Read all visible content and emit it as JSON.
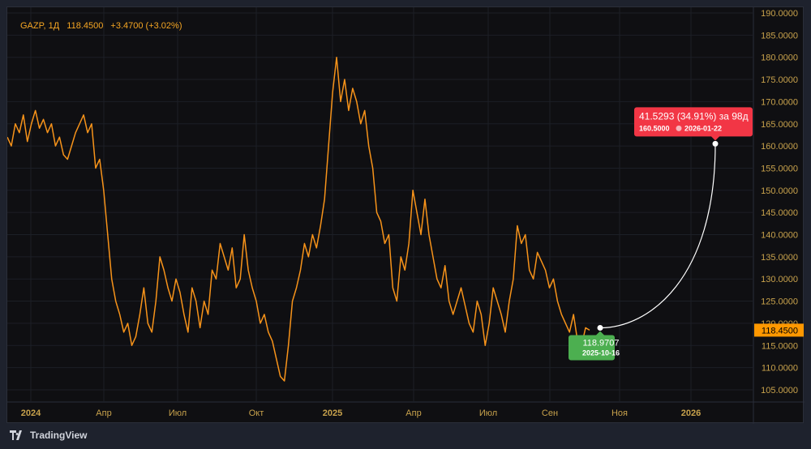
{
  "header": {
    "symbol": "GAZP, 1Д",
    "price": "118.4500",
    "change": "+3.4700 (+3.02%)"
  },
  "footer": {
    "brand": "TradingView"
  },
  "colors": {
    "line": "#f7931a",
    "accent": "#ff9800",
    "up_label": "#4caf50",
    "target_label": "#f23645",
    "axis_text": "#c8a24c"
  },
  "chart_data": {
    "type": "line",
    "title": "GAZP, 1Д",
    "xlabel": "",
    "ylabel": "",
    "ylim": [
      103,
      191
    ],
    "y_ticks": [
      "190.0000",
      "185.0000",
      "180.0000",
      "175.0000",
      "170.0000",
      "165.0000",
      "160.0000",
      "155.0000",
      "150.0000",
      "145.0000",
      "140.0000",
      "135.0000",
      "130.0000",
      "125.0000",
      "120.0000",
      "115.0000",
      "110.0000",
      "105.0000"
    ],
    "x_ticks": [
      "2024",
      "Апр",
      "Июл",
      "Окт",
      "2025",
      "Апр",
      "Июл",
      "Сен",
      "Ноя",
      "2026"
    ],
    "grid": true,
    "series": [
      {
        "name": "GAZP",
        "start_date": "2023-12",
        "end_date": "2025-10-16",
        "values": [
          162,
          160,
          165,
          163,
          167,
          161,
          165,
          168,
          164,
          166,
          163,
          165,
          160,
          162,
          158,
          157,
          160,
          163,
          165,
          167,
          163,
          165,
          155,
          157,
          150,
          140,
          130,
          125,
          122,
          118,
          120,
          115,
          117,
          122,
          128,
          120,
          118,
          125,
          135,
          132,
          128,
          125,
          130,
          127,
          122,
          118,
          128,
          125,
          119,
          125,
          122,
          132,
          130,
          138,
          135,
          132,
          137,
          128,
          130,
          140,
          132,
          128,
          125,
          120,
          122,
          118,
          116,
          112,
          108,
          107,
          115,
          125,
          128,
          132,
          138,
          135,
          140,
          137,
          142,
          148,
          160,
          172,
          180,
          170,
          175,
          168,
          173,
          170,
          165,
          168,
          160,
          155,
          145,
          143,
          138,
          140,
          128,
          125,
          135,
          132,
          138,
          150,
          145,
          140,
          148,
          140,
          135,
          130,
          128,
          133,
          125,
          122,
          125,
          128,
          124,
          120,
          118,
          125,
          122,
          115,
          120,
          128,
          125,
          122,
          118,
          125,
          130,
          142,
          138,
          140,
          132,
          130,
          136,
          134,
          132,
          128,
          130,
          125,
          122,
          120,
          118,
          122,
          116,
          115,
          119,
          118.45
        ]
      }
    ],
    "last_price_label": "118.4500",
    "projection": {
      "start_value": "118.9707",
      "start_date": "2025-10-16",
      "end_value": "160.5000",
      "end_date": "2026-01-22",
      "change_text": "41.5293 (34.91%) за 98д",
      "start_num": 118.9707,
      "end_num": 160.5
    }
  }
}
